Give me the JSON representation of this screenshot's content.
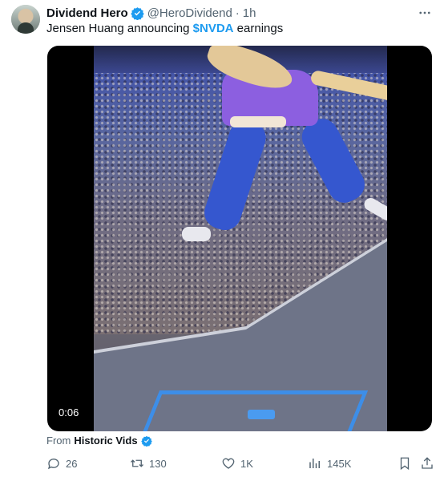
{
  "author": {
    "display_name": "Dividend Hero",
    "handle": "@HeroDividend",
    "separator": "·",
    "time": "1h"
  },
  "tweet": {
    "text_before": "Jensen Huang announcing ",
    "cashtag": "$NVDA",
    "text_after": " earnings"
  },
  "video": {
    "timestamp": "0:06"
  },
  "source": {
    "prefix": "From",
    "name": "Historic Vids"
  },
  "actions": {
    "replies": "26",
    "reposts": "130",
    "likes": "1K",
    "views": "145K"
  },
  "icons": {
    "more": "more-icon",
    "verified": "verified-badge-icon",
    "reply": "reply-icon",
    "repost": "repost-icon",
    "like": "heart-icon",
    "views": "views-icon",
    "bookmark": "bookmark-icon",
    "share": "share-icon"
  },
  "colors": {
    "accent": "#1d9bf0",
    "muted": "#536471",
    "text": "#0f1419"
  }
}
